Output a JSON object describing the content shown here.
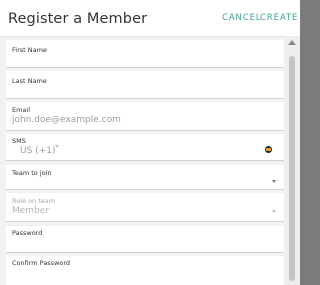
{
  "dialog": {
    "title": "Register a Member",
    "cancel_label": "CANCEL",
    "create_label": "CREATE"
  },
  "fields": {
    "first_name": {
      "label": "First Name",
      "value": ""
    },
    "last_name": {
      "label": "Last Name",
      "value": ""
    },
    "email": {
      "label": "Email",
      "placeholder": "john.doe@example.com"
    },
    "sms": {
      "label": "SMS",
      "country_code": "US (+1)",
      "flag_icon": "us-flag-icon"
    },
    "team": {
      "label": "Team to join",
      "value": ""
    },
    "role": {
      "label": "Role on team",
      "value": "Member"
    },
    "password": {
      "label": "Password",
      "value": ""
    },
    "confirm_password": {
      "label": "Confirm Password",
      "value": ""
    }
  },
  "colors": {
    "accent": "#3f9e96",
    "header_bg": "#ffffff",
    "form_bg": "#f2f2f2"
  }
}
